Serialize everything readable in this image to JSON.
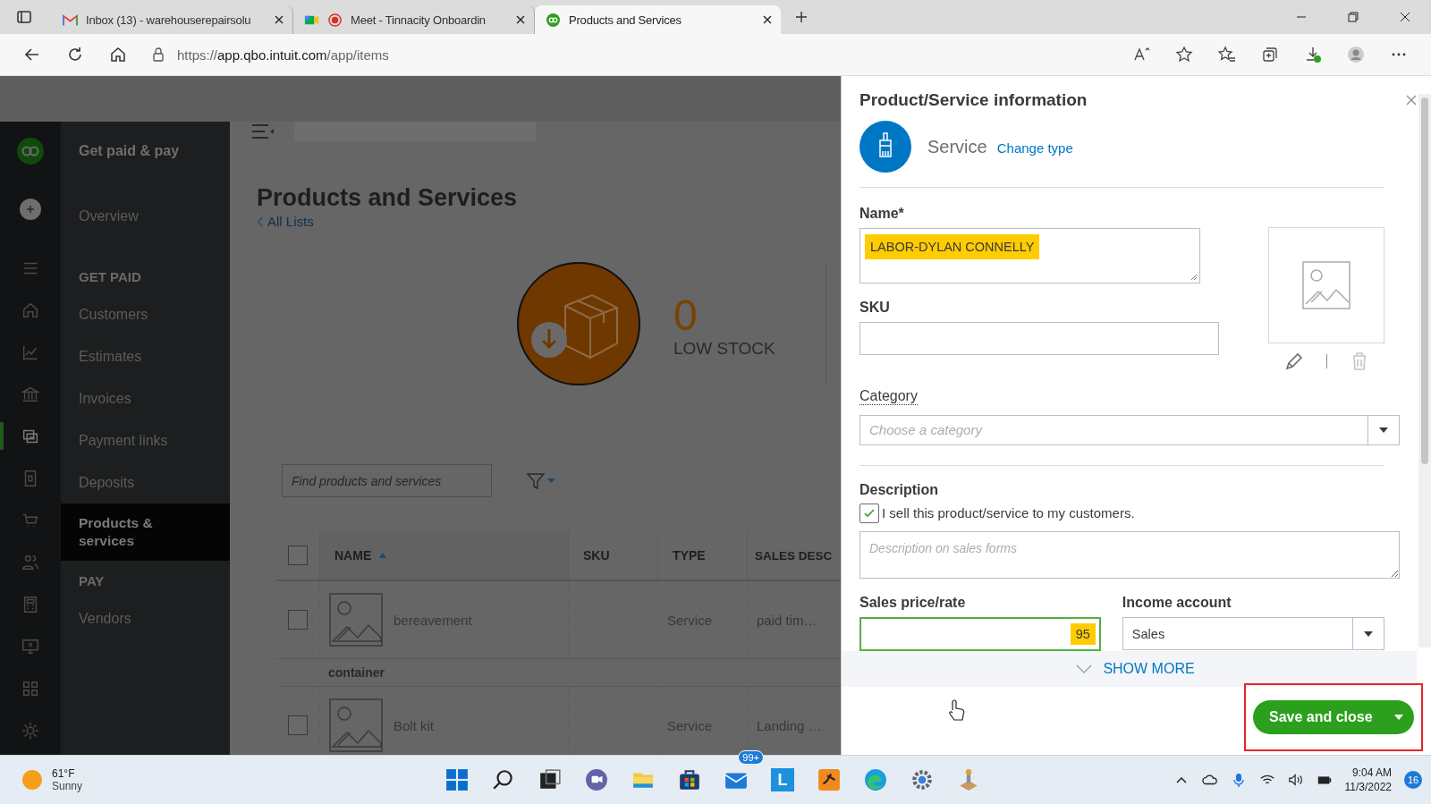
{
  "browser": {
    "tabs": [
      {
        "kind": "gmail",
        "title": "Inbox (13) - warehouserepairsolu",
        "selected": false
      },
      {
        "kind": "meet",
        "title": "Meet - Tinnacity Onboardin",
        "selected": false
      },
      {
        "kind": "qb",
        "title": "Products and Services",
        "selected": true
      }
    ],
    "url": {
      "scheme": "https://",
      "host": "app.qbo.intuit.com",
      "path": "/app/items"
    }
  },
  "rail": [
    {
      "selected": false
    },
    {
      "selected": false
    },
    {
      "selected": false
    },
    {
      "selected": false
    },
    {
      "selected": true
    },
    {
      "selected": false
    },
    {
      "selected": false
    },
    {
      "selected": false
    },
    {
      "selected": false
    },
    {
      "selected": false
    },
    {
      "selected": false
    },
    {
      "selected": false
    }
  ],
  "sidebar": {
    "title": "Get paid & pay",
    "items": [
      {
        "kind": "link",
        "label": "Overview",
        "selected": false
      },
      {
        "kind": "heading",
        "label": "GET PAID"
      },
      {
        "kind": "link",
        "label": "Customers",
        "selected": false
      },
      {
        "kind": "link",
        "label": "Estimates",
        "selected": false
      },
      {
        "kind": "link",
        "label": "Invoices",
        "selected": false
      },
      {
        "kind": "link",
        "label": "Payment links",
        "selected": false
      },
      {
        "kind": "link",
        "label": "Deposits",
        "selected": false
      },
      {
        "kind": "link",
        "label": "Products & services",
        "selected": true
      },
      {
        "kind": "heading",
        "label": "PAY"
      },
      {
        "kind": "link",
        "label": "Vendors",
        "selected": false
      }
    ]
  },
  "main": {
    "title": "Products and Services",
    "back_link": "All Lists",
    "stat": {
      "value": "0",
      "label": "LOW STOCK"
    },
    "search": {
      "placeholder": "Find products and services"
    },
    "table": {
      "select_all_checked": false,
      "columns": [
        "NAME",
        "SKU",
        "TYPE",
        "SALES DESC"
      ],
      "rows": [
        {
          "kind": "item",
          "checked": false,
          "name": "bereavement",
          "type": "Service",
          "description": "paid tim…"
        },
        {
          "kind": "group",
          "name": "container"
        },
        {
          "kind": "item",
          "checked": false,
          "name": "Bolt kit",
          "type": "Service",
          "description": "Landing …"
        }
      ]
    }
  },
  "panel": {
    "title": "Product/Service information",
    "type": "Service",
    "change_type": "Change type",
    "name": {
      "label": "Name*",
      "value": "LABOR-DYLAN CONNELLY",
      "highlighted": true
    },
    "sku": {
      "label": "SKU"
    },
    "category": {
      "label": "Category",
      "placeholder": "Choose a category"
    },
    "description": {
      "label": "Description",
      "checkbox_label": "I sell this product/service to my customers.",
      "checked": true,
      "placeholder": "Description on sales forms"
    },
    "sales_price": {
      "label": "Sales price/rate",
      "value": "95",
      "highlighted": true
    },
    "income_account": {
      "label": "Income account",
      "value": "Sales"
    },
    "show_more": "SHOW MORE",
    "save_button": {
      "label": "Save and close",
      "outlined": true
    }
  },
  "taskbar": {
    "weather": {
      "temp": "61°F",
      "condition": "Sunny"
    },
    "apps": [
      {
        "kind": "start"
      },
      {
        "kind": "search"
      },
      {
        "kind": "taskview"
      },
      {
        "kind": "chat"
      },
      {
        "kind": "folder"
      },
      {
        "kind": "store"
      },
      {
        "kind": "mail",
        "badge": "99+"
      },
      {
        "kind": "letter",
        "letter": "L"
      },
      {
        "kind": "app"
      },
      {
        "kind": "edge"
      },
      {
        "kind": "settings"
      },
      {
        "kind": "tool"
      }
    ],
    "time": "9:04 AM",
    "date": "11/3/2022",
    "notifications": "16"
  }
}
